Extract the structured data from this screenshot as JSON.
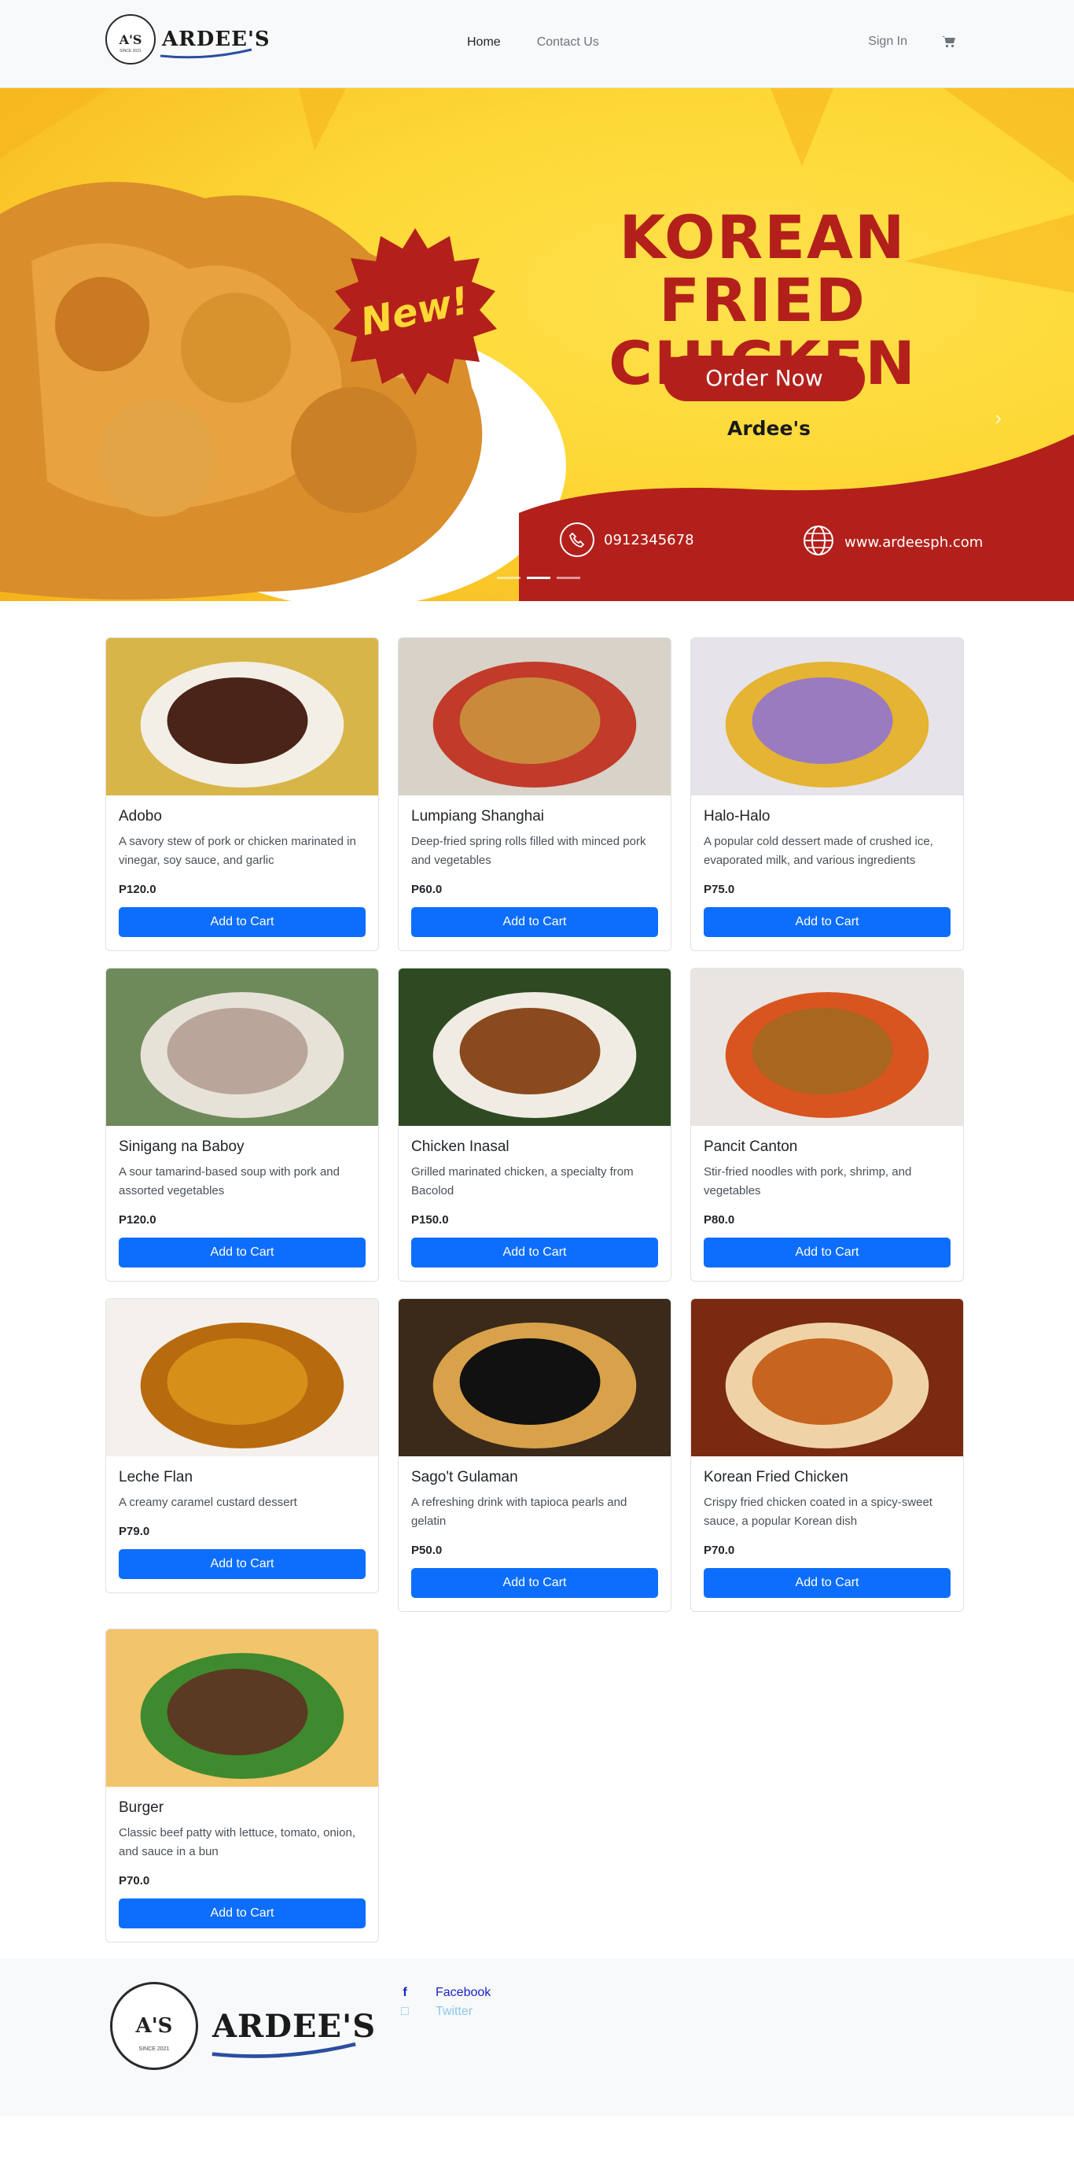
{
  "navbar": {
    "brand_mark": "A'S",
    "brand_since": "SINCE 2021",
    "brand_name": "ARDEE'S",
    "links": [
      {
        "label": "Home",
        "active": true
      },
      {
        "label": "Contact Us",
        "active": false
      }
    ],
    "sign_in": "Sign In",
    "cart_icon": "cart-icon"
  },
  "hero": {
    "badge": "New!",
    "headline_line1": "KOREAN",
    "headline_line2": "FRIED CHICKEN",
    "cta": "Order Now",
    "brand": "Ardee's",
    "phone": "0912345678",
    "website": "www.ardeesph.com",
    "slides": 3,
    "active_slide": 2,
    "colors": {
      "yellow": "#fdd835",
      "red": "#b3201b"
    }
  },
  "menu": {
    "button_label": "Add to Cart",
    "items": [
      {
        "name": "Adobo",
        "description": "A savory stew of pork or chicken marinated in vinegar, soy sauce, and garlic",
        "price": "P120.0"
      },
      {
        "name": "Lumpiang Shanghai",
        "description": "Deep-fried spring rolls filled with minced pork and vegetables",
        "price": "P60.0"
      },
      {
        "name": "Halo-Halo",
        "description": "A popular cold dessert made of crushed ice, evaporated milk, and various ingredients",
        "price": "P75.0"
      },
      {
        "name": "Sinigang na Baboy",
        "description": "A sour tamarind-based soup with pork and assorted vegetables",
        "price": "P120.0"
      },
      {
        "name": "Chicken Inasal",
        "description": "Grilled marinated chicken, a specialty from Bacolod",
        "price": "P150.0"
      },
      {
        "name": "Pancit Canton",
        "description": "Stir-fried noodles with pork, shrimp, and vegetables",
        "price": "P80.0"
      },
      {
        "name": "Leche Flan",
        "description": "A creamy caramel custard dessert",
        "price": "P79.0"
      },
      {
        "name": "Sago't Gulaman",
        "description": "A refreshing drink with tapioca pearls and gelatin",
        "price": "P50.0"
      },
      {
        "name": "Korean Fried Chicken",
        "description": "Crispy fried chicken coated in a spicy-sweet sauce, a popular Korean dish",
        "price": "P70.0"
      },
      {
        "name": "Burger",
        "description": "Classic beef patty with lettuce, tomato, onion, and sauce in a bun",
        "price": "P70.0"
      }
    ]
  },
  "footer": {
    "brand_mark": "A'S",
    "brand_since": "SINCE 2021",
    "brand_name": "ARDEE'S",
    "social": [
      {
        "label": "Facebook",
        "icon": "facebook-icon"
      },
      {
        "label": "Twitter",
        "icon": "twitter-icon"
      }
    ]
  }
}
